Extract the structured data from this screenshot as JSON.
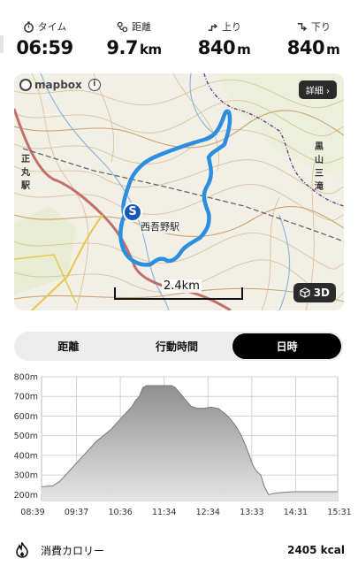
{
  "stats": [
    {
      "label": "タイム",
      "value": "06:59",
      "unit": "",
      "icon": "stopwatch-icon"
    },
    {
      "label": "距離",
      "value": "9.7",
      "unit": "km",
      "icon": "route-icon"
    },
    {
      "label": "上り",
      "value": "840",
      "unit": "m",
      "icon": "ascent-icon"
    },
    {
      "label": "下り",
      "value": "840",
      "unit": "m",
      "icon": "descent-icon"
    }
  ],
  "map": {
    "attribution": "mapbox",
    "detail_button": "詳細",
    "view_3d_button": "3D",
    "scale_label": "2.4km",
    "start_marker": "S",
    "station_label": "西吾野駅",
    "route_color": "#2a8fe0"
  },
  "tabs": [
    {
      "label": "距離",
      "active": false
    },
    {
      "label": "行動時間",
      "active": false
    },
    {
      "label": "日時",
      "active": true
    }
  ],
  "chart_data": {
    "type": "area",
    "title": "",
    "xlabel": "",
    "ylabel": "",
    "x_ticks": [
      "08:39",
      "09:37",
      "10:36",
      "11:34",
      "12:34",
      "13:33",
      "14:31",
      "15:31"
    ],
    "y_ticks": [
      "200m",
      "300m",
      "400m",
      "500m",
      "600m",
      "700m",
      "800m"
    ],
    "ylim": [
      170,
      800
    ],
    "xlim_minutes": [
      519,
      931
    ],
    "grid": true,
    "series": [
      {
        "points": [
          [
            519,
            240
          ],
          [
            535,
            245
          ],
          [
            545,
            270
          ],
          [
            555,
            310
          ],
          [
            565,
            350
          ],
          [
            575,
            390
          ],
          [
            585,
            430
          ],
          [
            595,
            470
          ],
          [
            605,
            500
          ],
          [
            615,
            530
          ],
          [
            625,
            570
          ],
          [
            635,
            610
          ],
          [
            645,
            650
          ],
          [
            650,
            680
          ],
          [
            655,
            700
          ],
          [
            660,
            745
          ],
          [
            665,
            755
          ],
          [
            680,
            755
          ],
          [
            695,
            755
          ],
          [
            700,
            755
          ],
          [
            705,
            745
          ],
          [
            712,
            715
          ],
          [
            720,
            680
          ],
          [
            727,
            650
          ],
          [
            735,
            640
          ],
          [
            745,
            640
          ],
          [
            755,
            645
          ],
          [
            765,
            638
          ],
          [
            775,
            610
          ],
          [
            782,
            585
          ],
          [
            790,
            545
          ],
          [
            797,
            500
          ],
          [
            803,
            450
          ],
          [
            808,
            400
          ],
          [
            813,
            350
          ],
          [
            818,
            320
          ],
          [
            824,
            300
          ],
          [
            829,
            240
          ],
          [
            835,
            200
          ],
          [
            840,
            205
          ],
          [
            850,
            210
          ],
          [
            870,
            215
          ],
          [
            900,
            215
          ],
          [
            931,
            215
          ]
        ]
      }
    ]
  },
  "footer": {
    "calorie_label": "消費カロリー",
    "calorie_value": "2405 kcal",
    "icon": "flame-icon"
  }
}
